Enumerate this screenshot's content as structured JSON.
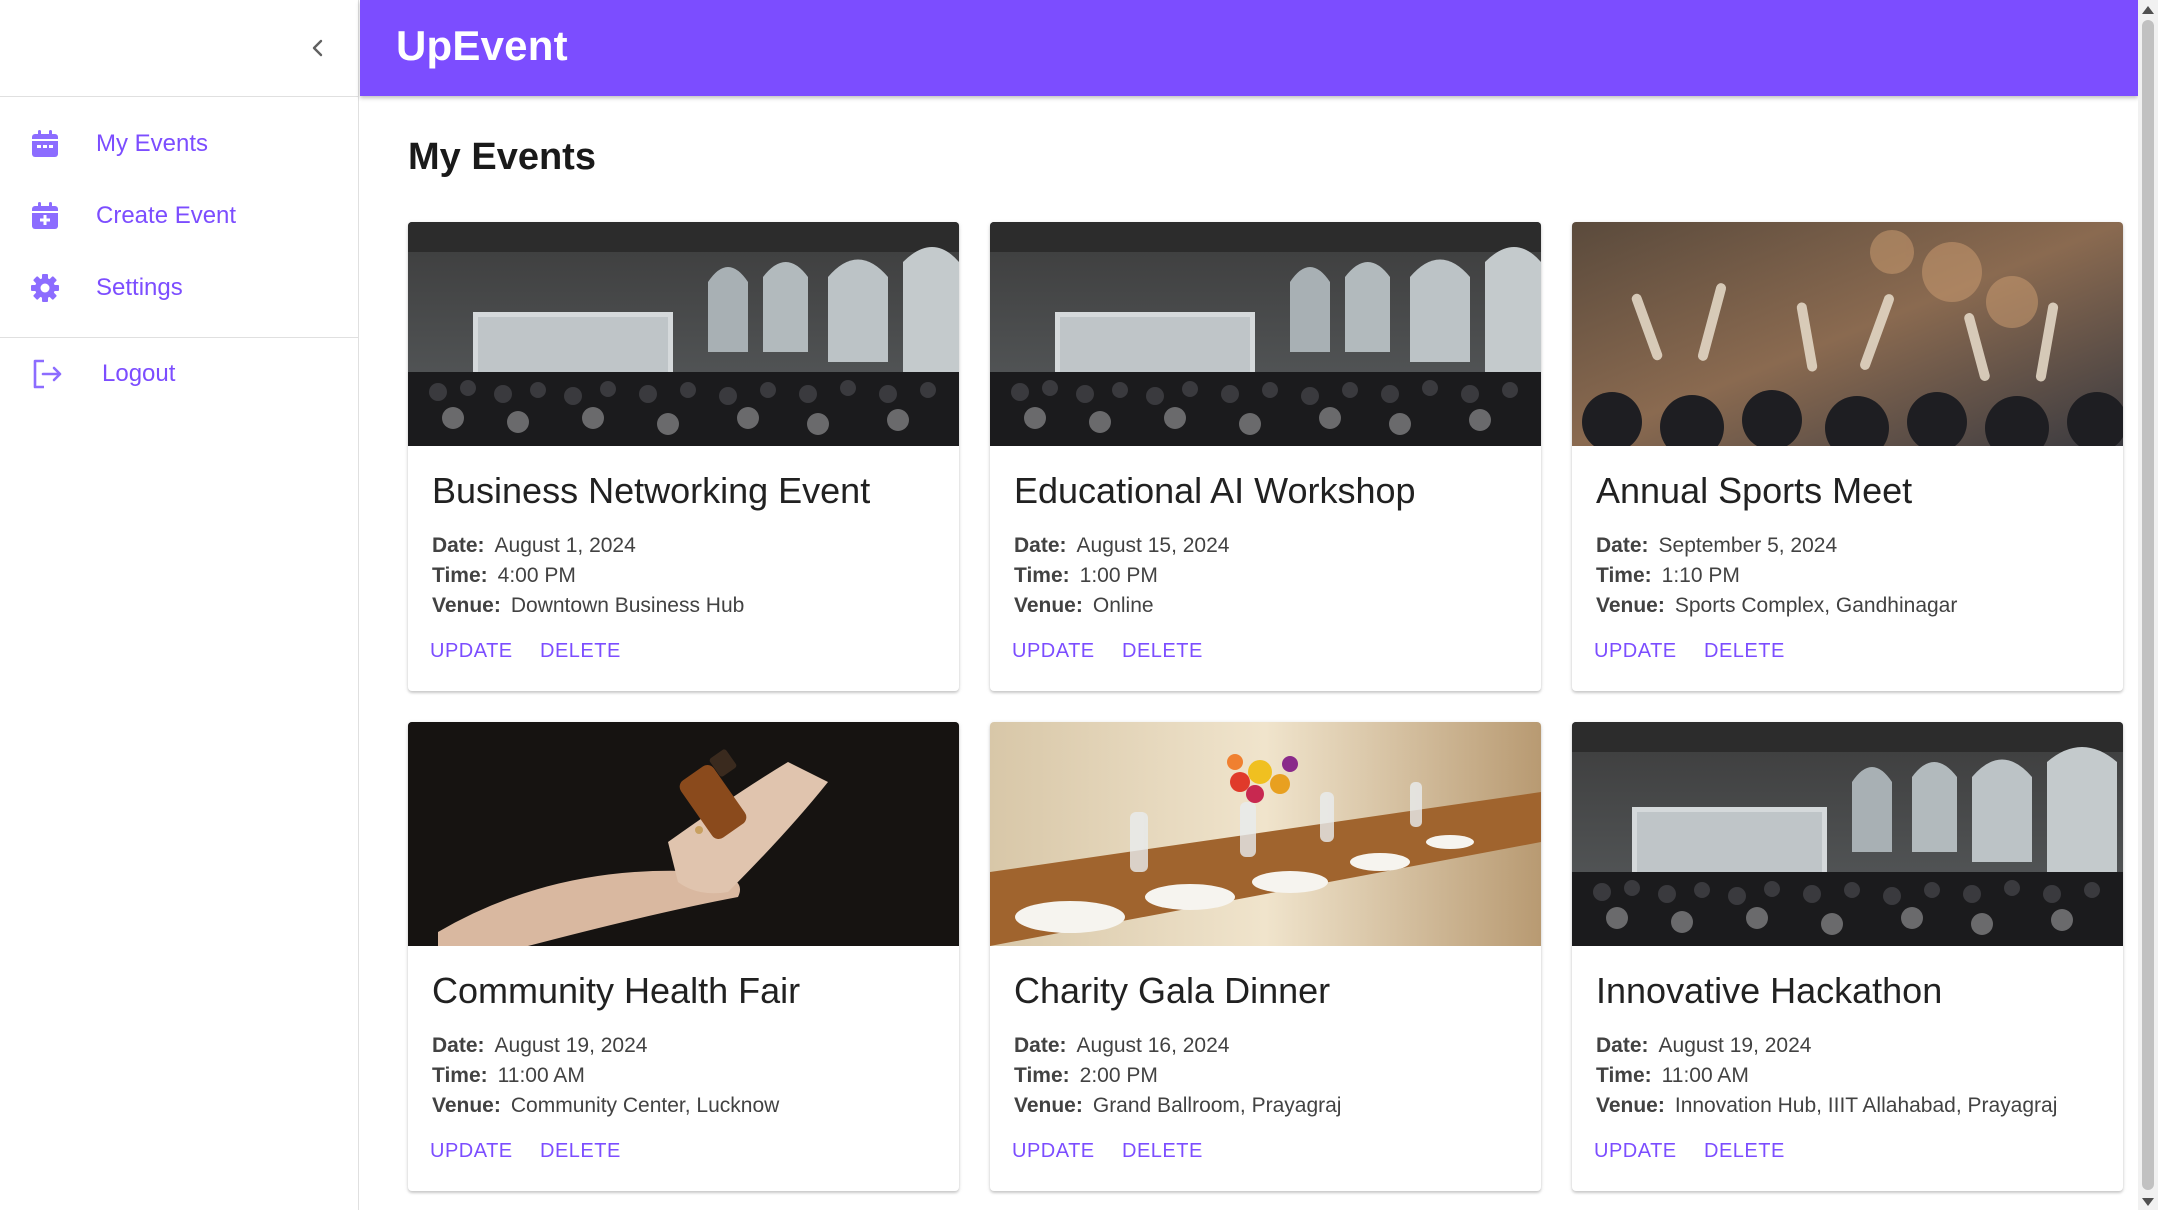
{
  "app": {
    "brand": "UpEvent"
  },
  "sidebar": {
    "collapse_icon": "chevron-left-icon",
    "items": [
      {
        "label": "My Events",
        "icon": "calendar-icon"
      },
      {
        "label": "Create Event",
        "icon": "calendar-add-icon"
      },
      {
        "label": "Settings",
        "icon": "gear-icon"
      },
      {
        "label": "Logout",
        "icon": "logout-icon"
      }
    ]
  },
  "main": {
    "title": "My Events",
    "field_labels": {
      "date": "Date:",
      "time": "Time:",
      "venue": "Venue:"
    },
    "actions": {
      "update": "UPDATE",
      "delete": "DELETE"
    },
    "events": [
      {
        "title": "Business Networking Event",
        "date": "August 1, 2024",
        "time": "4:00 PM",
        "venue": "Downtown Business Hub",
        "image": "conference-hall-photo"
      },
      {
        "title": "Educational AI Workshop",
        "date": "August 15, 2024",
        "time": "1:00 PM",
        "venue": "Online",
        "image": "conference-hall-photo"
      },
      {
        "title": "Annual Sports Meet",
        "date": "September 5, 2024",
        "time": "1:10 PM",
        "venue": "Sports Complex, Gandhinagar",
        "image": "concert-crowd-photo"
      },
      {
        "title": "Community Health Fair",
        "date": "August 19, 2024",
        "time": "11:00 AM",
        "venue": "Community Center, Lucknow",
        "image": "dropper-bottle-hand-photo"
      },
      {
        "title": "Charity Gala Dinner",
        "date": "August 16, 2024",
        "time": "2:00 PM",
        "venue": "Grand Ballroom, Prayagraj",
        "image": "banquet-table-photo"
      },
      {
        "title": "Innovative Hackathon",
        "date": "August 19, 2024",
        "time": "11:00 AM",
        "venue": "Innovation Hub, IIIT Allahabad, Prayagraj",
        "image": "conference-hall-photo"
      }
    ]
  },
  "colors": {
    "primary": "#7c4dff",
    "text": "#212121",
    "muted": "#424242"
  }
}
